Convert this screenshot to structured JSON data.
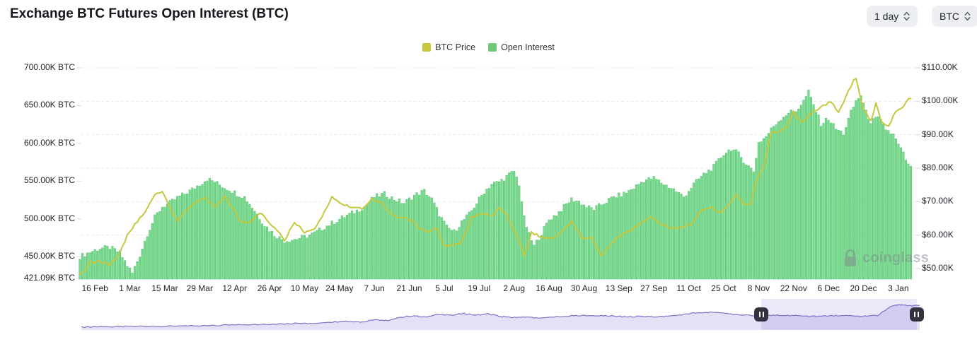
{
  "header": {
    "title": "Exchange BTC Futures Open Interest (BTC)"
  },
  "controls": {
    "interval": {
      "value": "1 day"
    },
    "unit": {
      "value": "BTC"
    }
  },
  "legend": [
    {
      "label": "BTC Price",
      "color": "#c7c83f"
    },
    {
      "label": "Open Interest",
      "color": "#6fc87a"
    }
  ],
  "watermark": {
    "text": "coinglass"
  },
  "chart_data": {
    "type": "mixed",
    "title": "Exchange BTC Futures Open Interest (BTC)",
    "grid": "dashed-horizontal",
    "legend_position": "top-center",
    "x_axis": {
      "tick_labels": [
        "16 Feb",
        "1 Mar",
        "15 Mar",
        "29 Mar",
        "12 Apr",
        "26 Apr",
        "10 May",
        "24 May",
        "7 Jun",
        "21 Jun",
        "5 Jul",
        "19 Jul",
        "2 Aug",
        "16 Aug",
        "30 Aug",
        "13 Sep",
        "27 Sep",
        "11 Oct",
        "25 Oct",
        "8 Nov",
        "22 Nov",
        "6 Dec",
        "20 Dec",
        "3 Jan"
      ],
      "tick_interval_days": 14,
      "first_tick_day_index": 6,
      "day_count": 334
    },
    "left_axis": {
      "unit": "K BTC",
      "min": 421.09,
      "max": 700,
      "ticks": [
        {
          "label": "700.00K BTC",
          "value": 700
        },
        {
          "label": "650.00K BTC",
          "value": 650
        },
        {
          "label": "600.00K BTC",
          "value": 600
        },
        {
          "label": "550.00K BTC",
          "value": 550
        },
        {
          "label": "500.00K BTC",
          "value": 500
        },
        {
          "label": "450.00K BTC",
          "value": 450
        },
        {
          "label": "421.09K BTC",
          "value": 421.09
        }
      ]
    },
    "right_axis": {
      "unit": "$K",
      "ticks": [
        {
          "label": "$110.00K",
          "value": 110
        },
        {
          "label": "$100.00K",
          "value": 100
        },
        {
          "label": "$90.00K",
          "value": 90
        },
        {
          "label": "$80.00K",
          "value": 80
        },
        {
          "label": "$70.00K",
          "value": 70
        },
        {
          "label": "$60.00K",
          "value": 60
        },
        {
          "label": "$50.00K",
          "value": 50
        }
      ]
    },
    "series": [
      {
        "name": "Open Interest",
        "type": "bar",
        "axis": "left",
        "unit": "K BTC",
        "color": "#78da8c",
        "stroke": "#4fc06e",
        "points": [
          [
            0,
            450
          ],
          [
            4,
            456
          ],
          [
            8,
            461
          ],
          [
            12,
            462
          ],
          [
            16,
            455
          ],
          [
            19,
            438
          ],
          [
            21,
            428
          ],
          [
            24,
            452
          ],
          [
            27,
            480
          ],
          [
            30,
            502
          ],
          [
            33,
            516
          ],
          [
            36,
            521
          ],
          [
            39,
            528
          ],
          [
            42,
            533
          ],
          [
            45,
            539
          ],
          [
            48,
            546
          ],
          [
            51,
            553
          ],
          [
            54,
            549
          ],
          [
            57,
            543
          ],
          [
            60,
            539
          ],
          [
            63,
            533
          ],
          [
            66,
            529
          ],
          [
            70,
            511
          ],
          [
            74,
            492
          ],
          [
            78,
            479
          ],
          [
            82,
            471
          ],
          [
            86,
            473
          ],
          [
            90,
            476
          ],
          [
            94,
            481
          ],
          [
            98,
            489
          ],
          [
            102,
            496
          ],
          [
            106,
            503
          ],
          [
            110,
            509
          ],
          [
            114,
            516
          ],
          [
            118,
            529
          ],
          [
            122,
            533
          ],
          [
            126,
            526
          ],
          [
            130,
            521
          ],
          [
            134,
            531
          ],
          [
            138,
            537
          ],
          [
            141,
            526
          ],
          [
            144,
            506
          ],
          [
            147,
            489
          ],
          [
            150,
            483
          ],
          [
            153,
            496
          ],
          [
            156,
            506
          ],
          [
            159,
            521
          ],
          [
            162,
            536
          ],
          [
            165,
            546
          ],
          [
            168,
            549
          ],
          [
            171,
            556
          ],
          [
            174,
            563
          ],
          [
            176,
            546
          ],
          [
            178,
            501
          ],
          [
            180,
            479
          ],
          [
            182,
            464
          ],
          [
            185,
            481
          ],
          [
            188,
            499
          ],
          [
            191,
            506
          ],
          [
            194,
            516
          ],
          [
            197,
            526
          ],
          [
            200,
            523
          ],
          [
            203,
            516
          ],
          [
            206,
            513
          ],
          [
            210,
            521
          ],
          [
            214,
            529
          ],
          [
            218,
            533
          ],
          [
            222,
            541
          ],
          [
            226,
            551
          ],
          [
            230,
            554
          ],
          [
            234,
            546
          ],
          [
            238,
            539
          ],
          [
            242,
            529
          ],
          [
            246,
            546
          ],
          [
            250,
            559
          ],
          [
            254,
            569
          ],
          [
            258,
            586
          ],
          [
            261,
            593
          ],
          [
            264,
            586
          ],
          [
            267,
            573
          ],
          [
            270,
            563
          ],
          [
            272,
            601
          ],
          [
            275,
            609
          ],
          [
            278,
            623
          ],
          [
            281,
            633
          ],
          [
            284,
            641
          ],
          [
            287,
            643
          ],
          [
            290,
            656
          ],
          [
            292,
            668
          ],
          [
            294,
            651
          ],
          [
            297,
            626
          ],
          [
            300,
            633
          ],
          [
            303,
            619
          ],
          [
            306,
            613
          ],
          [
            309,
            641
          ],
          [
            311,
            656
          ],
          [
            313,
            664
          ],
          [
            315,
            641
          ],
          [
            317,
            629
          ],
          [
            320,
            633
          ],
          [
            323,
            619
          ],
          [
            326,
            611
          ],
          [
            328,
            598
          ],
          [
            330,
            586
          ],
          [
            332,
            571
          ],
          [
            333,
            567
          ]
        ]
      },
      {
        "name": "BTC Price",
        "type": "line",
        "axis": "right",
        "unit": "$K",
        "color": "#c5c83e",
        "points": [
          [
            0,
            48.0
          ],
          [
            2,
            49.5
          ],
          [
            4,
            51.8
          ],
          [
            8,
            52.1
          ],
          [
            12,
            51.0
          ],
          [
            16,
            54.5
          ],
          [
            19,
            60.0
          ],
          [
            22,
            63.1
          ],
          [
            26,
            66.9
          ],
          [
            30,
            72.1
          ],
          [
            33,
            73.1
          ],
          [
            36,
            68.4
          ],
          [
            39,
            63.8
          ],
          [
            42,
            67.2
          ],
          [
            46,
            69.5
          ],
          [
            50,
            71.3
          ],
          [
            54,
            68.5
          ],
          [
            58,
            71.6
          ],
          [
            62,
            67.2
          ],
          [
            64,
            64.0
          ],
          [
            68,
            63.5
          ],
          [
            72,
            66.8
          ],
          [
            76,
            63.8
          ],
          [
            80,
            60.6
          ],
          [
            82,
            58.3
          ],
          [
            86,
            64.0
          ],
          [
            90,
            60.8
          ],
          [
            94,
            61.6
          ],
          [
            98,
            67.0
          ],
          [
            101,
            71.4
          ],
          [
            105,
            69.3
          ],
          [
            109,
            68.4
          ],
          [
            113,
            67.8
          ],
          [
            117,
            70.8
          ],
          [
            121,
            69.6
          ],
          [
            125,
            66.0
          ],
          [
            129,
            65.2
          ],
          [
            133,
            64.3
          ],
          [
            136,
            61.8
          ],
          [
            140,
            61.0
          ],
          [
            143,
            62.1
          ],
          [
            146,
            56.6
          ],
          [
            149,
            57.0
          ],
          [
            153,
            57.9
          ],
          [
            157,
            65.1
          ],
          [
            161,
            66.7
          ],
          [
            165,
            65.4
          ],
          [
            168,
            68.3
          ],
          [
            171,
            66.2
          ],
          [
            174,
            61.5
          ],
          [
            176,
            58.1
          ],
          [
            178,
            54.0
          ],
          [
            181,
            60.7
          ],
          [
            185,
            59.4
          ],
          [
            189,
            58.9
          ],
          [
            193,
            61.2
          ],
          [
            197,
            64.2
          ],
          [
            201,
            59.1
          ],
          [
            205,
            59.1
          ],
          [
            209,
            53.9
          ],
          [
            213,
            57.6
          ],
          [
            217,
            60.0
          ],
          [
            221,
            61.7
          ],
          [
            225,
            63.6
          ],
          [
            229,
            65.2
          ],
          [
            233,
            63.3
          ],
          [
            237,
            62.1
          ],
          [
            241,
            62.3
          ],
          [
            245,
            63.2
          ],
          [
            249,
            67.6
          ],
          [
            253,
            68.4
          ],
          [
            257,
            66.7
          ],
          [
            261,
            69.9
          ],
          [
            263,
            72.3
          ],
          [
            266,
            69.4
          ],
          [
            269,
            69.4
          ],
          [
            271,
            75.9
          ],
          [
            274,
            80.4
          ],
          [
            277,
            90.5
          ],
          [
            280,
            91.0
          ],
          [
            283,
            92.3
          ],
          [
            286,
            97.0
          ],
          [
            289,
            93.5
          ],
          [
            292,
            95.9
          ],
          [
            295,
            97.3
          ],
          [
            298,
            98.8
          ],
          [
            301,
            99.9
          ],
          [
            304,
            96.6
          ],
          [
            307,
            101.4
          ],
          [
            310,
            106.1
          ],
          [
            311,
            106.7
          ],
          [
            314,
            97.5
          ],
          [
            317,
            94.3
          ],
          [
            319,
            99.3
          ],
          [
            321,
            94.2
          ],
          [
            324,
            92.6
          ],
          [
            327,
            96.9
          ],
          [
            330,
            98.3
          ],
          [
            332,
            100.6
          ],
          [
            333,
            101.0
          ]
        ]
      }
    ],
    "navigator": {
      "line_color": "#7e72c6",
      "fill_color": "#e4e0f6",
      "overlay_color": "rgba(127,110,217,0.16)",
      "selected_range": [
        0.811,
        0.9966
      ],
      "points": [
        [
          0.0,
          0.1
        ],
        [
          0.03,
          0.1
        ],
        [
          0.06,
          0.12
        ],
        [
          0.09,
          0.11
        ],
        [
          0.12,
          0.14
        ],
        [
          0.15,
          0.14
        ],
        [
          0.18,
          0.16
        ],
        [
          0.21,
          0.18
        ],
        [
          0.24,
          0.19
        ],
        [
          0.26,
          0.22
        ],
        [
          0.28,
          0.21
        ],
        [
          0.3,
          0.26
        ],
        [
          0.32,
          0.28
        ],
        [
          0.335,
          0.25
        ],
        [
          0.35,
          0.33
        ],
        [
          0.365,
          0.3
        ],
        [
          0.38,
          0.4
        ],
        [
          0.395,
          0.45
        ],
        [
          0.41,
          0.42
        ],
        [
          0.425,
          0.5
        ],
        [
          0.44,
          0.48
        ],
        [
          0.455,
          0.53
        ],
        [
          0.47,
          0.48
        ],
        [
          0.485,
          0.52
        ],
        [
          0.5,
          0.43
        ],
        [
          0.515,
          0.4
        ],
        [
          0.53,
          0.42
        ],
        [
          0.55,
          0.38
        ],
        [
          0.57,
          0.43
        ],
        [
          0.59,
          0.47
        ],
        [
          0.61,
          0.45
        ],
        [
          0.63,
          0.46
        ],
        [
          0.65,
          0.42
        ],
        [
          0.67,
          0.44
        ],
        [
          0.69,
          0.42
        ],
        [
          0.71,
          0.46
        ],
        [
          0.73,
          0.55
        ],
        [
          0.75,
          0.57
        ],
        [
          0.77,
          0.52
        ],
        [
          0.79,
          0.48
        ],
        [
          0.81,
          0.45
        ],
        [
          0.83,
          0.48
        ],
        [
          0.85,
          0.46
        ],
        [
          0.87,
          0.44
        ],
        [
          0.89,
          0.45
        ],
        [
          0.91,
          0.47
        ],
        [
          0.93,
          0.44
        ],
        [
          0.95,
          0.47
        ],
        [
          0.965,
          0.75
        ],
        [
          0.975,
          0.82
        ],
        [
          0.985,
          0.78
        ],
        [
          1.0,
          0.8
        ]
      ]
    }
  }
}
